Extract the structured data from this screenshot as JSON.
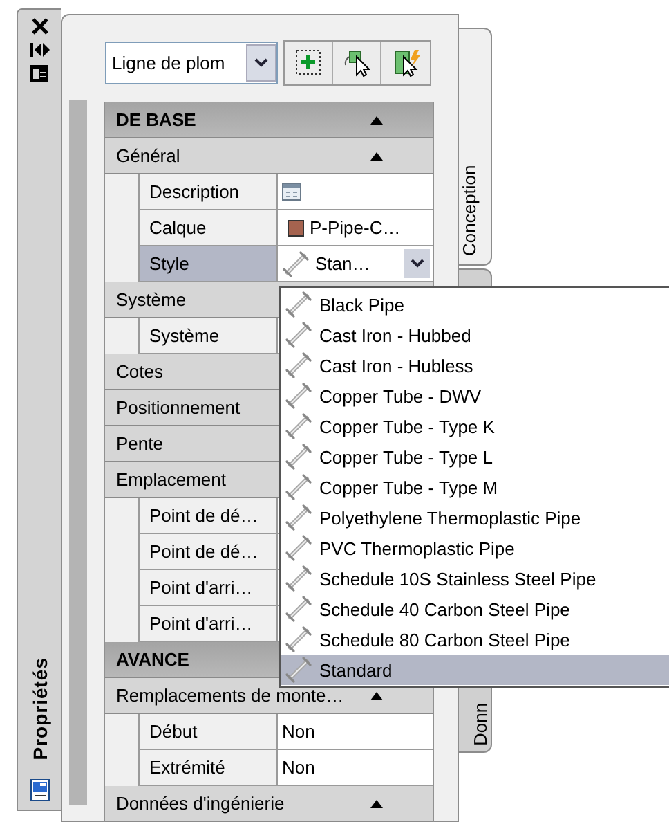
{
  "side_panel": {
    "title": "Propriétés"
  },
  "toolbar": {
    "object_type": "Ligne de plom"
  },
  "tabs": [
    {
      "label": "Conception",
      "selected": true
    },
    {
      "label": "Donn",
      "selected": false
    }
  ],
  "sections": [
    {
      "title": "DE BASE",
      "expanded": true,
      "categories": [
        {
          "title": "Général",
          "expanded": true,
          "properties": [
            {
              "label": "Description",
              "kind": "dialog",
              "selected": false
            },
            {
              "label": "Calque",
              "kind": "layer",
              "value": "P-Pipe-C…",
              "color": "#a5634f",
              "selected": false
            },
            {
              "label": "Style",
              "kind": "style",
              "value": "Stan…",
              "selected": true
            }
          ]
        },
        {
          "title": "Système",
          "properties": [
            {
              "label": "Système",
              "kind": "text",
              "selected": false
            }
          ]
        },
        {
          "title": "Cotes"
        },
        {
          "title": "Positionnement"
        },
        {
          "title": "Pente"
        },
        {
          "title": "Emplacement",
          "properties": [
            {
              "label": "Point de dé…",
              "kind": "text",
              "selected": false
            },
            {
              "label": "Point de dé…",
              "kind": "text",
              "selected": false
            },
            {
              "label": "Point d'arri…",
              "kind": "text",
              "selected": false
            },
            {
              "label": "Point d'arri…",
              "kind": "text",
              "selected": false
            }
          ]
        }
      ]
    },
    {
      "title": "AVANCE",
      "categories": [
        {
          "title": "Remplacements de monte…",
          "expanded": true,
          "properties": [
            {
              "label": "Début",
              "kind": "text",
              "value": "Non",
              "selected": false
            },
            {
              "label": "Extrémité",
              "kind": "text",
              "value": "Non",
              "selected": false
            }
          ]
        },
        {
          "title": "Données d'ingénierie",
          "expanded": true
        }
      ]
    }
  ],
  "style_menu": {
    "items": [
      {
        "label": "Black Pipe",
        "selected": false
      },
      {
        "label": "Cast Iron - Hubbed",
        "selected": false
      },
      {
        "label": "Cast Iron - Hubless",
        "selected": false
      },
      {
        "label": "Copper Tube - DWV",
        "selected": false
      },
      {
        "label": "Copper Tube - Type K",
        "selected": false
      },
      {
        "label": "Copper Tube - Type L",
        "selected": false
      },
      {
        "label": "Copper Tube - Type M",
        "selected": false
      },
      {
        "label": "Polyethylene Thermoplastic Pipe",
        "selected": false
      },
      {
        "label": "PVC Thermoplastic Pipe",
        "selected": false
      },
      {
        "label": "Schedule 10S Stainless Steel Pipe",
        "selected": false
      },
      {
        "label": "Schedule 40 Carbon Steel Pipe",
        "selected": false
      },
      {
        "label": "Schedule 80 Carbon Steel Pipe",
        "selected": false
      },
      {
        "label": "Standard",
        "selected": true
      }
    ]
  }
}
